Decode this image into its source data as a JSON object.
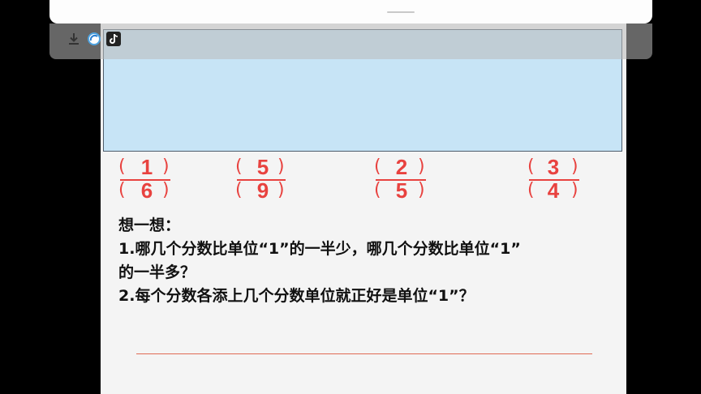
{
  "toolbar": {
    "icons": [
      "download-icon",
      "browser-icon",
      "tiktok-icon"
    ]
  },
  "fractions": [
    {
      "numerator": "1",
      "denominator": "6"
    },
    {
      "numerator": "5",
      "denominator": "9"
    },
    {
      "numerator": "2",
      "denominator": "5"
    },
    {
      "numerator": "3",
      "denominator": "4"
    }
  ],
  "parens": {
    "open": "(",
    "close": ")"
  },
  "think": {
    "heading": "想一想：",
    "q1_line1": "1.哪几个分数比单位“1”的一半少，哪几个分数比单位“1”",
    "q1_line2": "的一半多？",
    "q2": "2.每个分数各添上几个分数单位就正好是单位“1”？"
  },
  "colors": {
    "accent": "#e8423f",
    "panel": "#c7e4f6",
    "text": "#111111"
  }
}
